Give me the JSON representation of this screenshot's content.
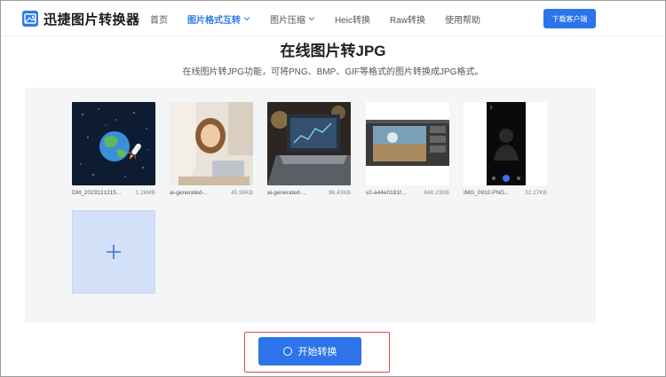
{
  "header": {
    "logo_text": "迅捷图片转换器",
    "nav": [
      {
        "label": "首页",
        "active": false,
        "dropdown": false
      },
      {
        "label": "图片格式互转",
        "active": true,
        "dropdown": true
      },
      {
        "label": "图片压缩",
        "active": false,
        "dropdown": true
      },
      {
        "label": "Heic转换",
        "active": false,
        "dropdown": false
      },
      {
        "label": "Raw转换",
        "active": false,
        "dropdown": false
      },
      {
        "label": "使用帮助",
        "active": false,
        "dropdown": false
      }
    ],
    "download_label": "下载客户端"
  },
  "main": {
    "title": "在线图片转JPG",
    "subtitle": "在线图片转JPG功能，可将PNG、BMP、GIF等格式的图片转换成JPG格式。",
    "files": [
      {
        "name": "DM_2023121215...",
        "size": "1.26MB",
        "thumb": "space-earth-rocket"
      },
      {
        "name": "ai-generated-...",
        "size": "45.99KB",
        "thumb": "woman-laptop-photo"
      },
      {
        "name": "ai-generated-...",
        "size": "96.43KB",
        "thumb": "laptop-photo"
      },
      {
        "name": "v2-a44e0181f...",
        "size": "648.23KB",
        "thumb": "photo-editor-screenshot"
      },
      {
        "name": "IMG_0910.PNG...",
        "size": "32.27KB",
        "thumb": "phone-camera-screenshot"
      }
    ],
    "add_icon": "plus-icon",
    "start_label": "开始转换"
  },
  "colors": {
    "accent": "#2d74ea",
    "highlight_frame": "#d84a4a",
    "panel_bg": "#f4f5f7",
    "add_tile_bg": "#d3e1f8"
  }
}
